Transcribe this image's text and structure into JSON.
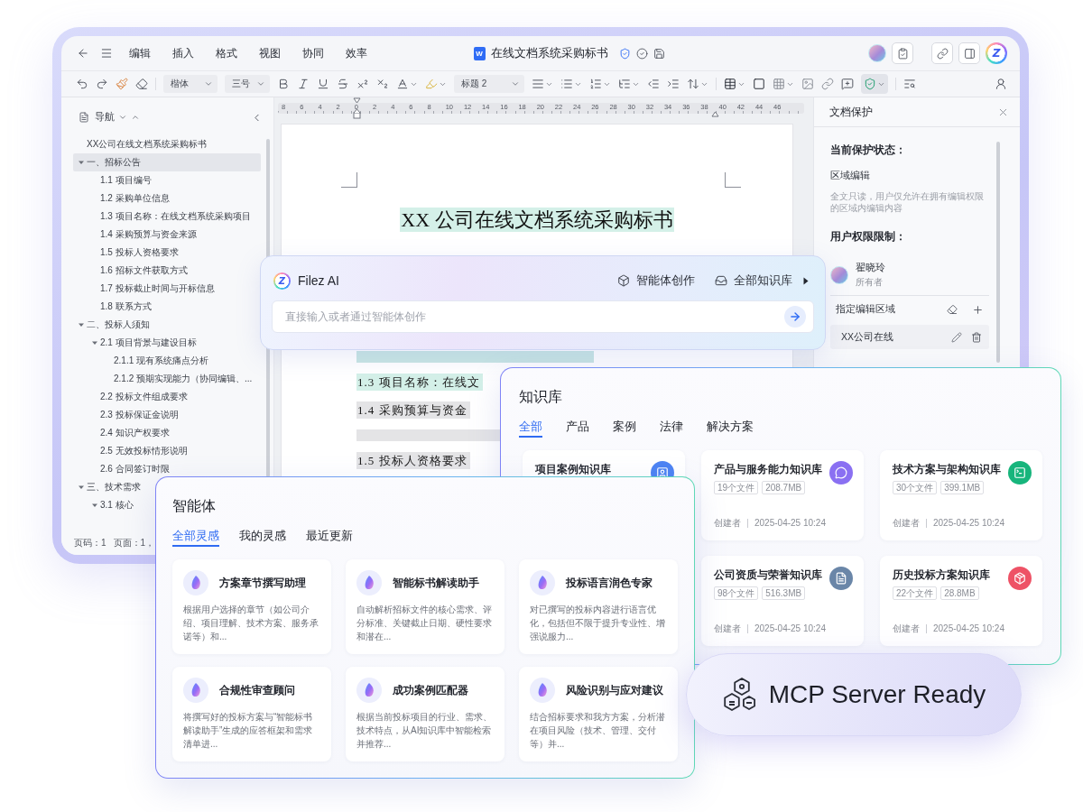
{
  "editor": {
    "top_bar": {
      "menus": [
        "编辑",
        "插入",
        "格式",
        "视图",
        "协同",
        "效率"
      ],
      "file_badge": "W",
      "title": "在线文档系统采购标书",
      "logo": "Z"
    },
    "format_toolbar": {
      "font": "楷体",
      "size": "三号",
      "style": "标题 2",
      "protect_active": true
    },
    "navigation": {
      "title": "导航",
      "items": [
        {
          "label": "XX公司在线文档系统采购标书",
          "selected": false
        },
        {
          "label": "一、招标公告",
          "selected": true,
          "expanded": true,
          "children": [
            {
              "label": "1.1 项目编号",
              "selected": false
            },
            {
              "label": "1.2 采购单位信息",
              "selected": false
            },
            {
              "label": "1.3 项目名称：在线文档系统采购项目",
              "selected": false
            },
            {
              "label": "1.4 采购预算与资金来源",
              "selected": false
            },
            {
              "label": "1.5 投标人资格要求",
              "selected": false
            },
            {
              "label": "1.6 招标文件获取方式",
              "selected": false
            },
            {
              "label": "1.7 投标截止时间与开标信息",
              "selected": false
            },
            {
              "label": "1.8 联系方式",
              "selected": false
            }
          ]
        },
        {
          "label": "二、投标人须知",
          "selected": false,
          "expanded": true,
          "children": [
            {
              "label": "2.1 项目背景与建设目标",
              "selected": false,
              "expanded": true,
              "children": [
                {
                  "label": "2.1.1 现有系统痛点分析",
                  "selected": false
                },
                {
                  "label": "2.1.2 预期实现能力（协同编辑、...",
                  "selected": false
                }
              ]
            },
            {
              "label": "2.2 投标文件组成要求",
              "selected": false
            },
            {
              "label": "2.3 投标保证金说明",
              "selected": false
            },
            {
              "label": "2.4 知识产权要求",
              "selected": false
            },
            {
              "label": "2.5 无效投标情形说明",
              "selected": false
            },
            {
              "label": "2.6 合同签订时限",
              "selected": false
            }
          ]
        },
        {
          "label": "三、技术需求",
          "selected": false,
          "expanded": true,
          "children": [
            {
              "label": "3.1 核心",
              "selected": false,
              "expanded": true
            }
          ]
        }
      ],
      "status": [
        "页码：1",
        "页面：1，"
      ]
    },
    "ruler": {
      "labels": [
        "8",
        "6",
        "4",
        "2",
        "0",
        "2",
        "4",
        "6",
        "8",
        "10",
        "12",
        "14",
        "16",
        "18",
        "20",
        "22",
        "24",
        "26",
        "28",
        "30",
        "32",
        "34",
        "36",
        "38",
        "40",
        "42",
        "44",
        "46"
      ]
    },
    "document": {
      "title": {
        "text": "XX 公司在线文档系统采购标书",
        "color": "#d4f0e8"
      },
      "lines": [
        {
          "kind": "blank",
          "color": "#c8e6e4"
        },
        {
          "kind": "text",
          "text": "1.3 项目名称：在线文",
          "color": "#d4f0e8"
        },
        {
          "kind": "text",
          "text": "1.4 采购预算与资金",
          "color": "#e4e4e6"
        },
        {
          "kind": "blank",
          "color": "#e4e4e6"
        },
        {
          "kind": "text",
          "text": "1.5 投标人资格要求",
          "color": "#e4e4e6"
        }
      ]
    },
    "protection_panel": {
      "title": "文档保护",
      "status_label": "当前保护状态：",
      "status": "区域编辑",
      "status_desc": "全文只读，用户仅允许在拥有编辑权限的区域内编辑内容",
      "users_label": "用户权限限制：",
      "users": [
        {
          "name": "翟晓玲",
          "role": "所有者"
        }
      ],
      "regions_label": "指定编辑区域",
      "regions": [
        "XX公司在线"
      ]
    }
  },
  "ai_assistant": {
    "logo": "Z",
    "name": "Filez AI",
    "actions": [
      "智能体创作",
      "全部知识库"
    ],
    "placeholder": "直接输入或者通过智能体创作"
  },
  "knowledge_base": {
    "title": "知识库",
    "tabs": [
      {
        "label": "全部",
        "selected": true
      },
      {
        "label": "产品",
        "selected": false
      },
      {
        "label": "案例",
        "selected": false
      },
      {
        "label": "法律",
        "selected": false
      },
      {
        "label": "解决方案",
        "selected": false
      }
    ],
    "cards": [
      {
        "title": "项目案例知识库",
        "color": "#4d84f3"
      },
      {
        "title": "产品与服务能力知识库",
        "color": "#8a70f2",
        "files": "19个文件",
        "size": "208.7MB",
        "creator": "创建者",
        "date": "2025-04-25 10:24"
      },
      {
        "title": "技术方案与架构知识库",
        "color": "#17b57c",
        "files": "30个文件",
        "size": "399.1MB",
        "creator": "创建者",
        "date": "2025-04-25 10:24"
      },
      {
        "title": "公司资质与荣誉知识库",
        "color": "#6a86a8",
        "files": "98个文件",
        "size": "516.3MB",
        "creator": "创建者",
        "date": "2025-04-25 10:24"
      },
      {
        "title": "历史投标方案知识库",
        "color": "#ee5266",
        "files": "22个文件",
        "size": "28.8MB",
        "creator": "创建者",
        "date": "2025-04-25 10:24"
      }
    ]
  },
  "agents": {
    "title": "智能体",
    "tabs": [
      {
        "label": "全部灵感",
        "selected": true
      },
      {
        "label": "我的灵感",
        "selected": false
      },
      {
        "label": "最近更新",
        "selected": false
      }
    ],
    "cards": [
      {
        "title": "方案章节撰写助理",
        "description": "根据用户选择的章节（如公司介绍、项目理解、技术方案、服务承诺等）和..."
      },
      {
        "title": "智能标书解读助手",
        "description": "自动解析招标文件的核心需求、评分标准、关键截止日期、硬性要求和潜在..."
      },
      {
        "title": "投标语言润色专家",
        "description": "对已撰写的投标内容进行语言优化，包括但不限于提升专业性、增强说服力..."
      },
      {
        "title": "合规性审查顾问",
        "description": "将撰写好的投标方案与“智能标书解读助手”生成的应答框架和需求清单进..."
      },
      {
        "title": "成功案例匹配器",
        "description": "根据当前投标项目的行业、需求、技术特点，从AI知识库中智能检索并推荐..."
      },
      {
        "title": "风险识别与应对建议",
        "description": "结合招标要求和我方方案，分析潜在项目风险（技术、管理、交付等）并..."
      }
    ]
  },
  "status_badge": {
    "text": "MCP Server Ready"
  }
}
